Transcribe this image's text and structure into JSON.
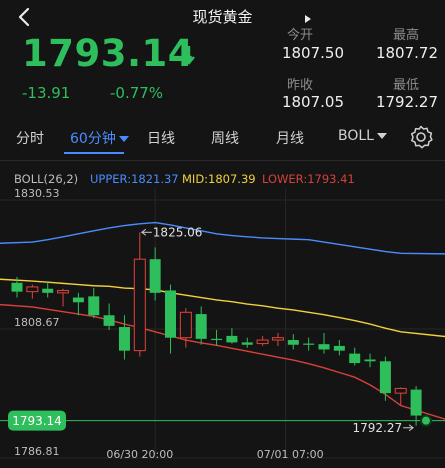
{
  "header": {
    "title": "现货黄金",
    "back_icon": "chevron-left-icon",
    "handle_icon": "triangle-right-icon"
  },
  "quote": {
    "price": "1793.14",
    "direction_icon": "arrow-down-icon",
    "change": "-13.91",
    "change_pct": "-0.77%",
    "stats": [
      {
        "label": "今开",
        "value": "1807.50"
      },
      {
        "label": "最高",
        "value": "1807.72"
      },
      {
        "label": "昨收",
        "value": "1807.05"
      },
      {
        "label": "最低",
        "value": "1792.27"
      }
    ]
  },
  "tabs": [
    {
      "label": "分时"
    },
    {
      "label": "60分钟",
      "active": true
    },
    {
      "label": "日线"
    },
    {
      "label": "周线"
    },
    {
      "label": "月线"
    },
    {
      "label": "BOLL"
    }
  ],
  "settings_icon": "gear-icon",
  "indicator": {
    "name": "BOLL(26,2)",
    "upper": "UPPER:1821.37",
    "mid": "MID:1807.39",
    "lower": "LOWER:1793.41"
  },
  "colors": {
    "up": "#e0433a",
    "down": "#2fbe5c",
    "upper": "#4a8cff",
    "mid": "#f2d23c",
    "lower": "#d8413a",
    "accent": "#4a8cff"
  },
  "chart_data": {
    "type": "candlestick",
    "y_ticks": [
      "1830.53",
      "1808.67",
      "1786.81"
    ],
    "ylim": [
      1786.81,
      1830.53
    ],
    "x_labels": [
      "06/30 20:00",
      "07/01 07:00"
    ],
    "current_price_label": "1793.14",
    "current_price": 1793.14,
    "annotations": [
      {
        "text": "1825.06",
        "value": 1825.06,
        "index": 8
      },
      {
        "text": "1792.27",
        "value": 1792.27,
        "index": 26
      }
    ],
    "candles": [
      {
        "o": 1816.5,
        "h": 1817.5,
        "l": 1814.0,
        "c": 1815.0
      },
      {
        "o": 1815.0,
        "h": 1816.2,
        "l": 1813.8,
        "c": 1815.8
      },
      {
        "o": 1815.5,
        "h": 1816.8,
        "l": 1814.0,
        "c": 1814.8
      },
      {
        "o": 1814.8,
        "h": 1815.5,
        "l": 1812.5,
        "c": 1815.2
      },
      {
        "o": 1814.0,
        "h": 1814.8,
        "l": 1811.0,
        "c": 1813.2
      },
      {
        "o": 1814.2,
        "h": 1815.6,
        "l": 1810.5,
        "c": 1811.0
      },
      {
        "o": 1811.0,
        "h": 1813.0,
        "l": 1808.5,
        "c": 1809.2
      },
      {
        "o": 1809.0,
        "h": 1811.0,
        "l": 1803.5,
        "c": 1805.0
      },
      {
        "o": 1805.0,
        "h": 1825.06,
        "l": 1804.0,
        "c": 1820.5
      },
      {
        "o": 1820.5,
        "h": 1822.5,
        "l": 1813.5,
        "c": 1814.8
      },
      {
        "o": 1815.2,
        "h": 1816.2,
        "l": 1804.5,
        "c": 1807.2
      },
      {
        "o": 1807.2,
        "h": 1812.2,
        "l": 1805.5,
        "c": 1811.5
      },
      {
        "o": 1811.2,
        "h": 1812.5,
        "l": 1806.0,
        "c": 1807.0
      },
      {
        "o": 1807.0,
        "h": 1808.5,
        "l": 1805.8,
        "c": 1806.8
      },
      {
        "o": 1807.5,
        "h": 1808.8,
        "l": 1806.2,
        "c": 1806.4
      },
      {
        "o": 1806.4,
        "h": 1807.2,
        "l": 1805.5,
        "c": 1806.0
      },
      {
        "o": 1806.2,
        "h": 1807.5,
        "l": 1805.8,
        "c": 1806.8
      },
      {
        "o": 1806.8,
        "h": 1808.0,
        "l": 1805.8,
        "c": 1807.2
      },
      {
        "o": 1806.8,
        "h": 1807.8,
        "l": 1805.2,
        "c": 1806.0
      },
      {
        "o": 1806.2,
        "h": 1807.2,
        "l": 1805.0,
        "c": 1806.1
      },
      {
        "o": 1806.1,
        "h": 1808.0,
        "l": 1804.5,
        "c": 1805.2
      },
      {
        "o": 1805.8,
        "h": 1806.8,
        "l": 1804.2,
        "c": 1805.0
      },
      {
        "o": 1804.5,
        "h": 1805.5,
        "l": 1802.5,
        "c": 1802.9
      },
      {
        "o": 1803.5,
        "h": 1804.5,
        "l": 1802.2,
        "c": 1803.2
      },
      {
        "o": 1803.2,
        "h": 1804.0,
        "l": 1796.5,
        "c": 1797.8
      },
      {
        "o": 1797.8,
        "h": 1798.8,
        "l": 1795.6,
        "c": 1798.6
      },
      {
        "o": 1798.4,
        "h": 1799.0,
        "l": 1792.27,
        "c": 1794.0
      }
    ],
    "series": [
      {
        "name": "UPPER",
        "values": [
          1823.2,
          1823.4,
          1823.8,
          1824.3,
          1824.8,
          1825.3,
          1825.8,
          1826.2,
          1826.5,
          1826.7,
          1826.3,
          1825.8,
          1825.3,
          1824.8,
          1824.5,
          1824.3,
          1824.1,
          1824.0,
          1823.9,
          1823.8,
          1823.4,
          1823.0,
          1822.6,
          1822.2,
          1821.8,
          1821.5,
          1821.4
        ]
      },
      {
        "name": "MID",
        "values": [
          1817.1,
          1816.8,
          1816.6,
          1816.4,
          1816.2,
          1816.0,
          1815.9,
          1815.6,
          1815.5,
          1815.3,
          1814.8,
          1814.4,
          1814.0,
          1813.6,
          1813.3,
          1812.9,
          1812.6,
          1812.2,
          1811.9,
          1811.5,
          1811.1,
          1810.6,
          1810.1,
          1809.5,
          1808.8,
          1808.2,
          1807.4
        ]
      },
      {
        "name": "LOWER",
        "values": [
          1812.8,
          1812.4,
          1812.0,
          1811.6,
          1811.2,
          1810.8,
          1810.2,
          1809.5,
          1808.9,
          1808.2,
          1807.5,
          1806.8,
          1806.3,
          1805.9,
          1805.4,
          1804.9,
          1804.4,
          1803.9,
          1803.4,
          1802.8,
          1802.1,
          1801.3,
          1800.5,
          1799.2,
          1797.6,
          1795.7,
          1793.4
        ]
      }
    ]
  }
}
